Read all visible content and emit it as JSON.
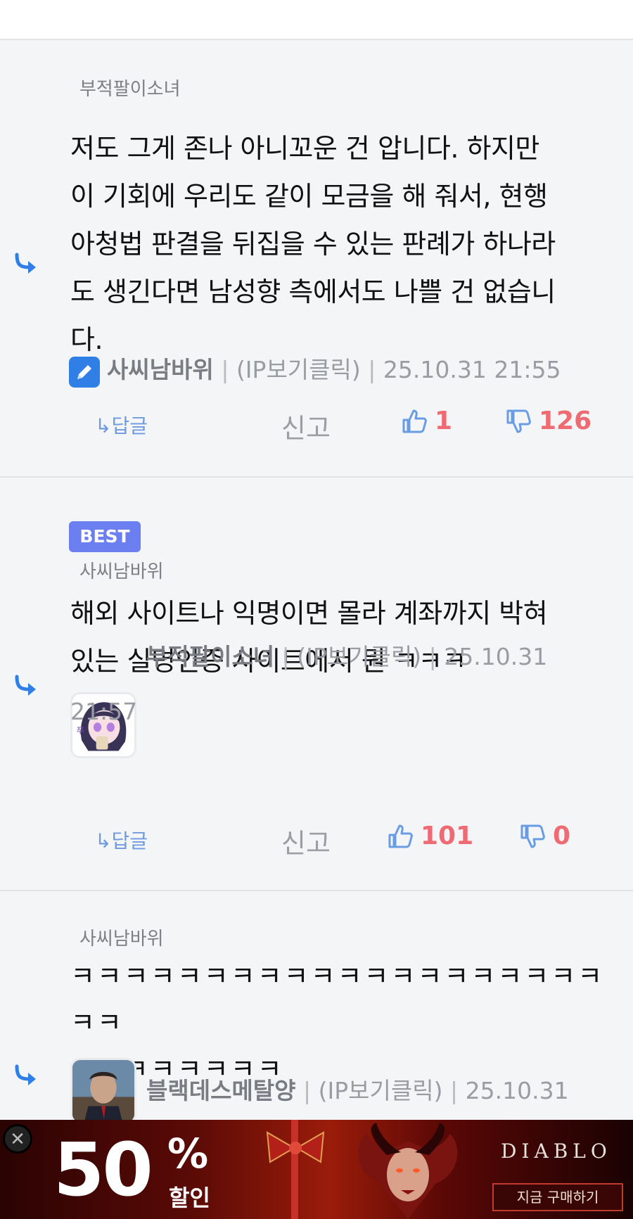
{
  "comments": [
    {
      "parent_name": "부적팔이소녀",
      "lines": [
        "저도 그게 존나 아니꼬운 건 압니다. 하지만",
        "이 기회에 우리도 같이 모금을 해 줘서, 현행",
        "아청법 판결을 뒤집을 수 있는 판례가 하나라",
        "도 생긴다면 남성향 측에서도 나쁠 건 없습니",
        "다."
      ],
      "author": "사씨남바위",
      "ip_text": "(IP보기클릭)",
      "datetime": "25.10.31 21:55",
      "reply_label": "↳답글",
      "report_label": "신고",
      "likes": "1",
      "dislikes": "126"
    },
    {
      "best_label": "BEST",
      "parent_name": "사씨남바위",
      "lines": [
        "해외 사이트나 익명이면 몰라 계좌까지 박혀",
        "있는 실명인증 사이트에서 뭔 ㅋㅋㅋ"
      ],
      "author": "부적팔이소녀",
      "ip_text": "(IP보기클릭)",
      "datetime_part1": "25.10.31",
      "datetime_part2": "21:57",
      "reply_label": "↳답글",
      "report_label": "신고",
      "likes": "101",
      "dislikes": "0"
    },
    {
      "parent_name": "사씨남바위",
      "lines": [
        "ㅋㅋㅋㅋㅋㅋㅋㅋㅋㅋㅋㅋㅋㅋㅋㅋㅋㅋㅋㅋㅋㅋ",
        "ㅋㅋㅋㅋㅋㅋㅋㅋ"
      ],
      "author": "블랙데스메탈양",
      "ip_text": "(IP보기클릭)",
      "datetime": "25.10.31"
    }
  ],
  "separator": "|",
  "ad": {
    "big_number": "50",
    "percent": "%",
    "sale_text": "할인",
    "logo_text": "DIABLO",
    "cta": "지금 구매하기",
    "close": "✕"
  },
  "colors": {
    "accent_blue": "#2f7fe6",
    "like_red": "#ee6b73",
    "best_badge": "#6b7ff0"
  }
}
